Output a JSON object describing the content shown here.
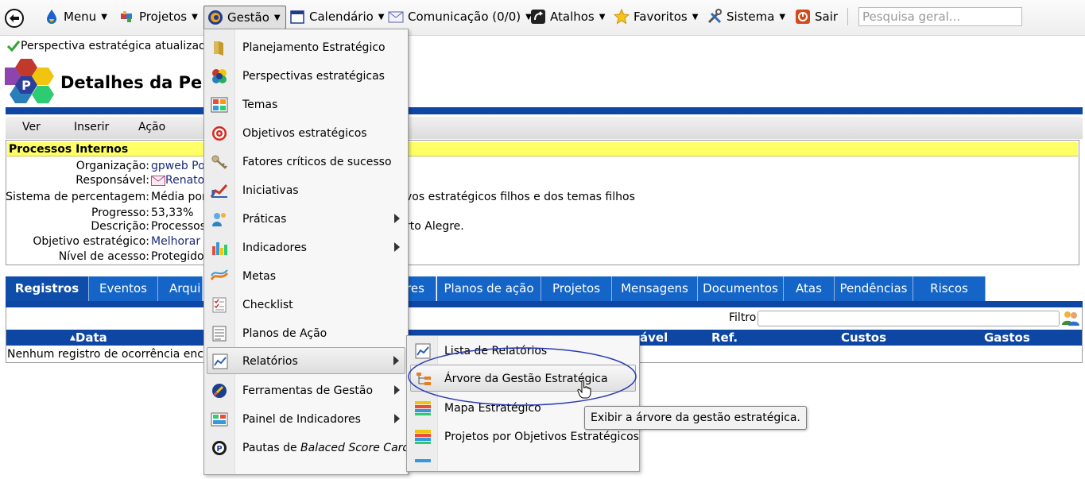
{
  "menubar": {
    "items": [
      {
        "label": "Menu",
        "icon": "drop-icon"
      },
      {
        "label": "Projetos",
        "icon": "puzzle-icon"
      },
      {
        "label": "Gestão",
        "icon": "gestao-icon"
      },
      {
        "label": "Calendário",
        "icon": "calendar-icon"
      },
      {
        "label": "Comunicação (0/0)",
        "icon": "mail-icon"
      },
      {
        "label": "Atalhos",
        "icon": "shortcut-icon"
      },
      {
        "label": "Favoritos",
        "icon": "star-icon"
      },
      {
        "label": "Sistema",
        "icon": "tools-icon"
      },
      {
        "label": "Sair",
        "icon": "power-icon"
      }
    ],
    "search_placeholder": "Pesquisa geral..."
  },
  "page": {
    "status": "Perspectiva estratégica atualizad",
    "title": "Detalhes da Per",
    "actions": [
      "Ver",
      "Inserir",
      "Ação"
    ]
  },
  "details": {
    "header": "Processos Internos",
    "rows": [
      {
        "label": "Organização:",
        "value": "gpweb Po",
        "extra": ""
      },
      {
        "label": "Responsável:",
        "value": "Renato",
        "extra": ""
      },
      {
        "label": "Sistema de percentagem:",
        "value": "Média por",
        "extra": "vos estratégicos filhos e dos temas filhos"
      },
      {
        "label": "Progresso:",
        "value": "53,33%",
        "extra": ""
      },
      {
        "label": "Descrição:",
        "value": "Processos",
        "extra": "rto Alegre."
      },
      {
        "label": "Objetivo estratégico:",
        "value": "Melhorar",
        "extra": ""
      },
      {
        "label": "Nível de acesso:",
        "value": "Protegido",
        "extra": ""
      }
    ]
  },
  "tabs": [
    "Registros",
    "Eventos",
    "Arqui",
    "res",
    "Planos de ação",
    "Projetos",
    "Mensagens",
    "Documentos",
    "Atas",
    "Pendências",
    "Riscos"
  ],
  "registros": {
    "filter_label": "Filtro",
    "columns": [
      "Data",
      "ável",
      "Ref.",
      "Custos",
      "Gastos"
    ],
    "empty_text": "Nenhum registro de ocorrência enc"
  },
  "gestao_menu": [
    {
      "label": "Planejamento Estratégico",
      "icon": "folder-icon",
      "sub": false
    },
    {
      "label": "Perspectivas estratégicas",
      "icon": "perspective-icon",
      "sub": false
    },
    {
      "label": "Temas",
      "icon": "themes-icon",
      "sub": false
    },
    {
      "label": "Objetivos estratégicos",
      "icon": "target-icon",
      "sub": false
    },
    {
      "label": "Fatores críticos de sucesso",
      "icon": "key-icon",
      "sub": false
    },
    {
      "label": "Iniciativas",
      "icon": "chart-icon",
      "sub": false
    },
    {
      "label": "Práticas",
      "icon": "practice-icon",
      "sub": true
    },
    {
      "label": "Indicadores",
      "icon": "bar-chart-icon",
      "sub": true
    },
    {
      "label": "Metas",
      "icon": "goals-icon",
      "sub": false
    },
    {
      "label": "Checklist",
      "icon": "checklist-icon",
      "sub": false
    },
    {
      "label": "Planos de Ação",
      "icon": "plan-icon",
      "sub": false
    },
    {
      "label": "Relatórios",
      "icon": "report-icon",
      "sub": true
    },
    {
      "label": "Ferramentas de Gestão",
      "icon": "tools-icon",
      "sub": true
    },
    {
      "label": "Painel de Indicadores",
      "icon": "dashboard-icon",
      "sub": true
    },
    {
      "label": "Pautas de ",
      "label_em": "Balaced Score Card",
      "icon": "bsc-icon",
      "sub": false
    }
  ],
  "relatorios_menu": [
    {
      "label": "Lista de Relatórios",
      "icon": "report-list-icon"
    },
    {
      "label": "Árvore da Gestão Estratégica",
      "icon": "tree-icon"
    },
    {
      "label": "Mapa Estratégico",
      "icon": "map-icon"
    },
    {
      "label": "Projetos por Objetivos Estratégicos",
      "icon": "projects-icon"
    }
  ],
  "tooltip": "Exibir a árvore da gestão estratégica.",
  "colors": {
    "nav_blue": "#0e46a4",
    "tab_blue": "#1565c8",
    "highlight_yellow": "#ffff66",
    "annotation": "#2a3bb5"
  }
}
